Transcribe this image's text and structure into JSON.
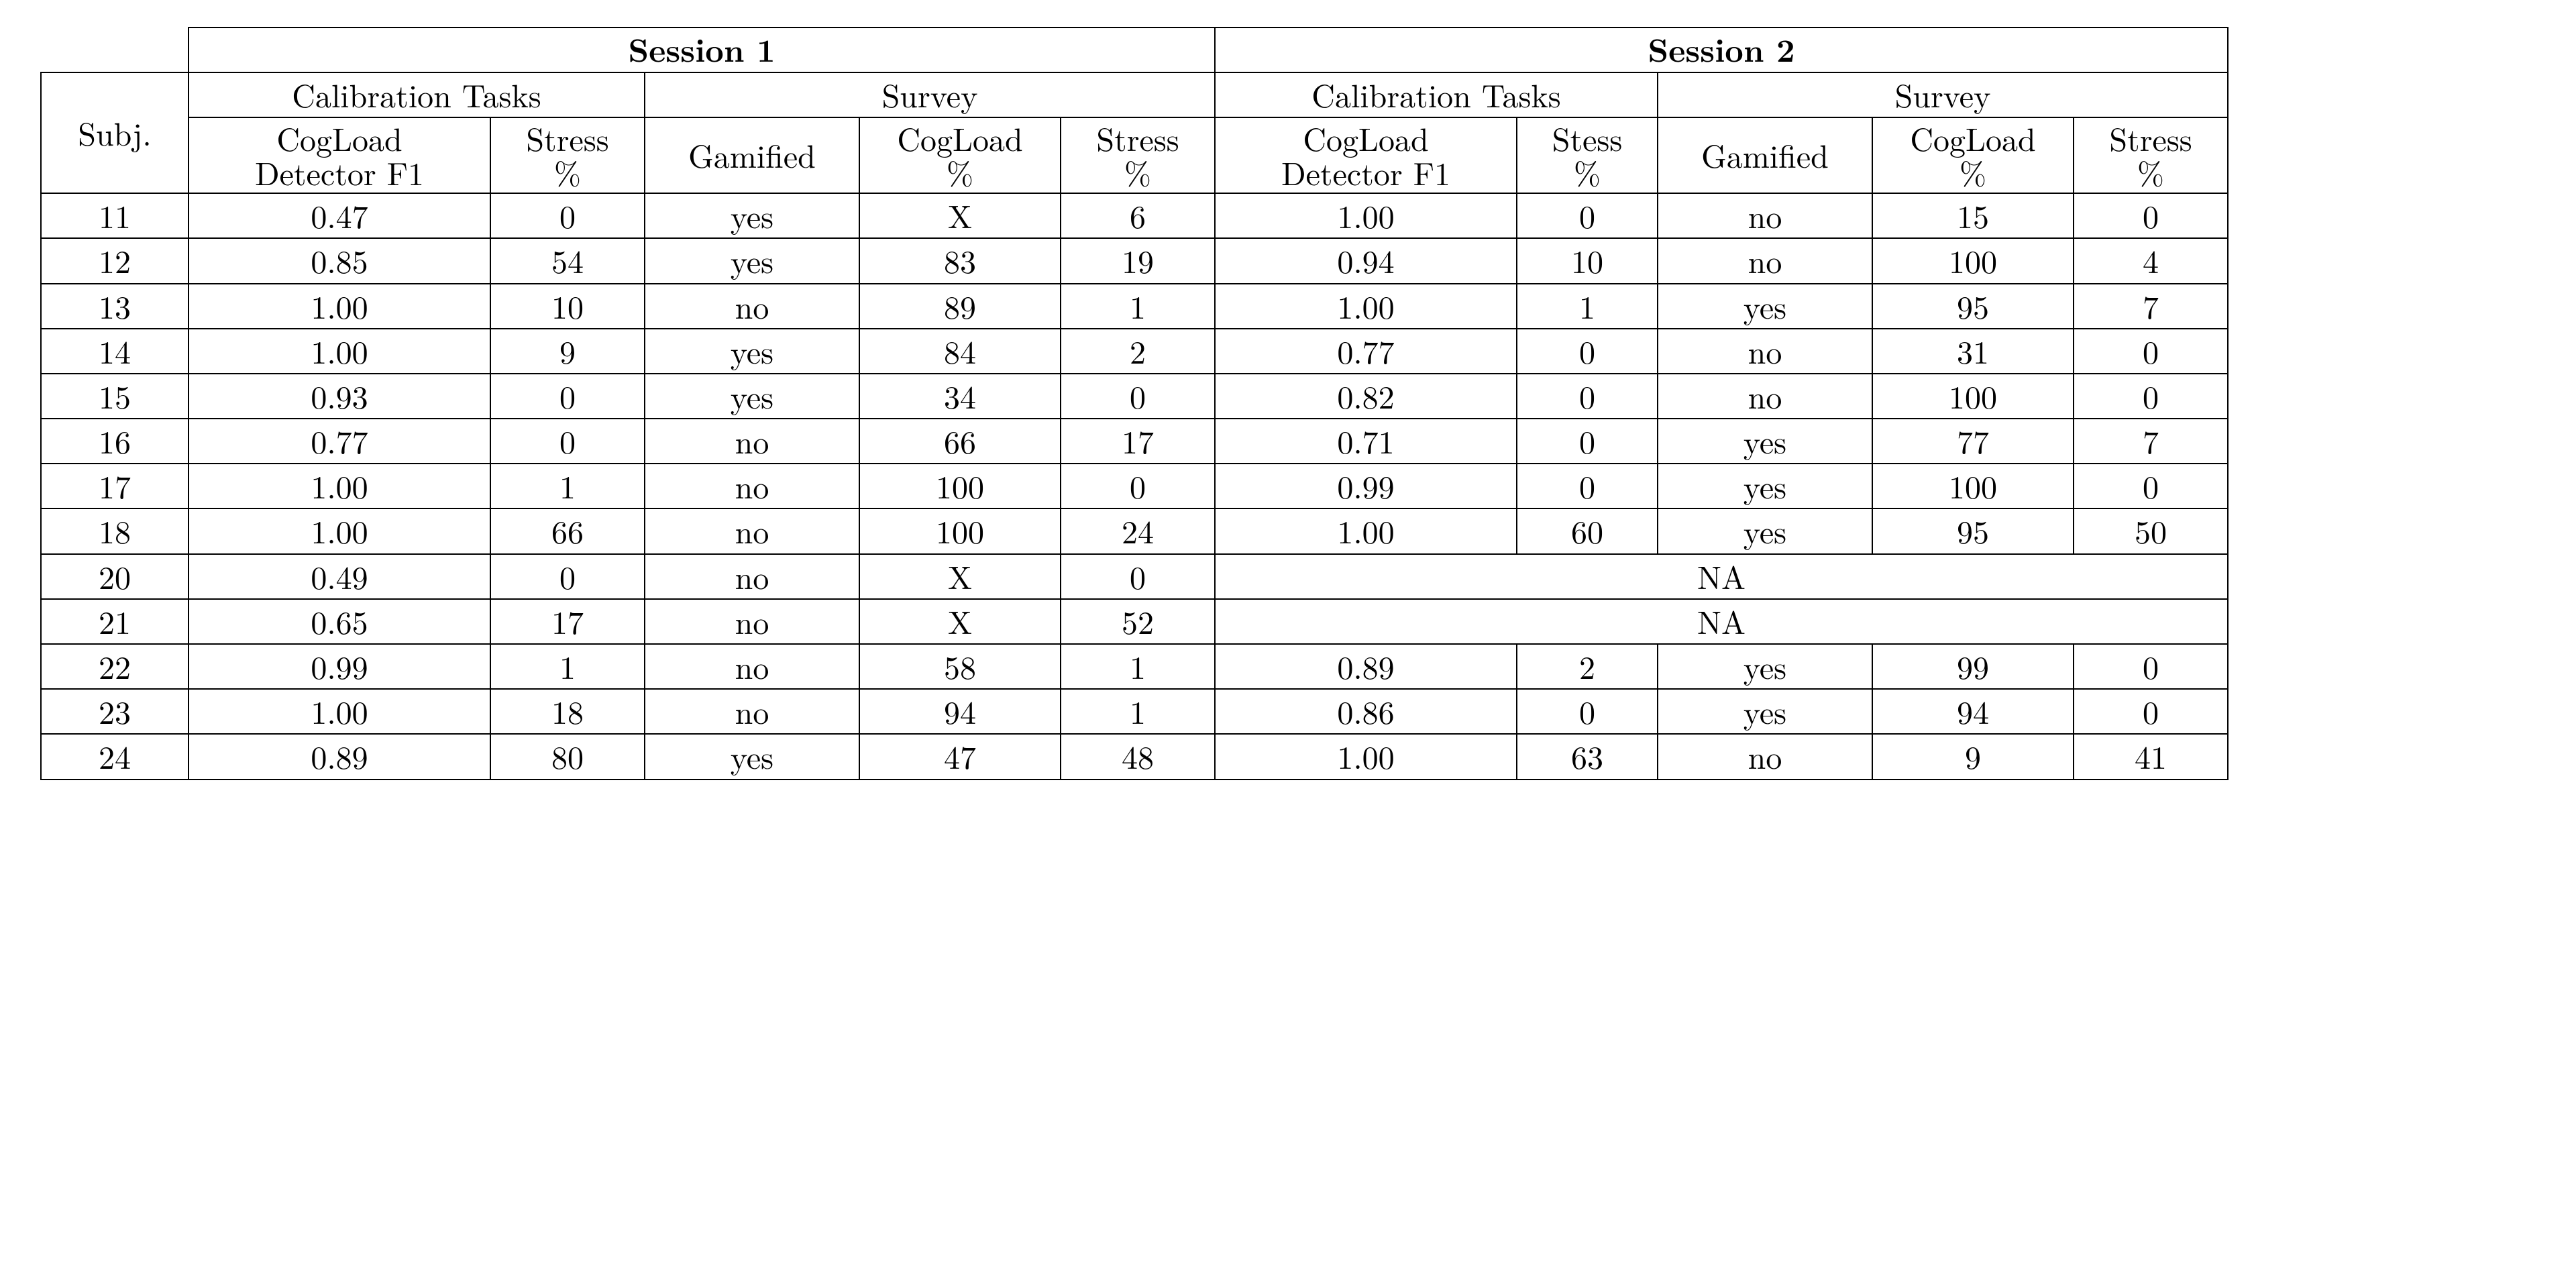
{
  "headers": {
    "subj": "Subj.",
    "session1": "Session 1",
    "session2": "Session 2",
    "calibration": "Calibration Tasks",
    "survey": "Survey",
    "cogload_f1_l1": "CogLoad",
    "cogload_f1_l2": "Detector F1",
    "stress_l1": "Stress",
    "stress_l2": "%",
    "stess_l1": "Stess",
    "gamified": "Gamified",
    "cogload_pct_l1": "CogLoad",
    "cogload_pct_l2": "%"
  },
  "na_label": "NA",
  "rows": [
    {
      "subj": "11",
      "s1": {
        "f1": "0.47",
        "st": "0",
        "gam": "yes",
        "cl": "X",
        "sp": "6"
      },
      "s2": {
        "f1": "1.00",
        "st": "0",
        "gam": "no",
        "cl": "15",
        "sp": "0"
      }
    },
    {
      "subj": "12",
      "s1": {
        "f1": "0.85",
        "st": "54",
        "gam": "yes",
        "cl": "83",
        "sp": "19"
      },
      "s2": {
        "f1": "0.94",
        "st": "10",
        "gam": "no",
        "cl": "100",
        "sp": "4"
      }
    },
    {
      "subj": "13",
      "s1": {
        "f1": "1.00",
        "st": "10",
        "gam": "no",
        "cl": "89",
        "sp": "1"
      },
      "s2": {
        "f1": "1.00",
        "st": "1",
        "gam": "yes",
        "cl": "95",
        "sp": "7"
      }
    },
    {
      "subj": "14",
      "s1": {
        "f1": "1.00",
        "st": "9",
        "gam": "yes",
        "cl": "84",
        "sp": "2"
      },
      "s2": {
        "f1": "0.77",
        "st": "0",
        "gam": "no",
        "cl": "31",
        "sp": "0"
      }
    },
    {
      "subj": "15",
      "s1": {
        "f1": "0.93",
        "st": "0",
        "gam": "yes",
        "cl": "34",
        "sp": "0"
      },
      "s2": {
        "f1": "0.82",
        "st": "0",
        "gam": "no",
        "cl": "100",
        "sp": "0"
      }
    },
    {
      "subj": "16",
      "s1": {
        "f1": "0.77",
        "st": "0",
        "gam": "no",
        "cl": "66",
        "sp": "17"
      },
      "s2": {
        "f1": "0.71",
        "st": "0",
        "gam": "yes",
        "cl": "77",
        "sp": "7"
      }
    },
    {
      "subj": "17",
      "s1": {
        "f1": "1.00",
        "st": "1",
        "gam": "no",
        "cl": "100",
        "sp": "0"
      },
      "s2": {
        "f1": "0.99",
        "st": "0",
        "gam": "yes",
        "cl": "100",
        "sp": "0"
      }
    },
    {
      "subj": "18",
      "s1": {
        "f1": "1.00",
        "st": "66",
        "gam": "no",
        "cl": "100",
        "sp": "24"
      },
      "s2": {
        "f1": "1.00",
        "st": "60",
        "gam": "yes",
        "cl": "95",
        "sp": "50"
      }
    },
    {
      "subj": "20",
      "s1": {
        "f1": "0.49",
        "st": "0",
        "gam": "no",
        "cl": "X",
        "sp": "0"
      },
      "s2": null
    },
    {
      "subj": "21",
      "s1": {
        "f1": "0.65",
        "st": "17",
        "gam": "no",
        "cl": "X",
        "sp": "52"
      },
      "s2": null
    },
    {
      "subj": "22",
      "s1": {
        "f1": "0.99",
        "st": "1",
        "gam": "no",
        "cl": "58",
        "sp": "1"
      },
      "s2": {
        "f1": "0.89",
        "st": "2",
        "gam": "yes",
        "cl": "99",
        "sp": "0"
      }
    },
    {
      "subj": "23",
      "s1": {
        "f1": "1.00",
        "st": "18",
        "gam": "no",
        "cl": "94",
        "sp": "1"
      },
      "s2": {
        "f1": "0.86",
        "st": "0",
        "gam": "yes",
        "cl": "94",
        "sp": "0"
      }
    },
    {
      "subj": "24",
      "s1": {
        "f1": "0.89",
        "st": "80",
        "gam": "yes",
        "cl": "47",
        "sp": "48"
      },
      "s2": {
        "f1": "1.00",
        "st": "63",
        "gam": "no",
        "cl": "9",
        "sp": "41"
      }
    }
  ],
  "chart_data": {
    "type": "table",
    "columns": [
      "Subj.",
      "Session1 Calibration CogLoad Detector F1",
      "Session1 Calibration Stress %",
      "Session1 Survey Gamified",
      "Session1 Survey CogLoad %",
      "Session1 Survey Stress %",
      "Session2 Calibration CogLoad Detector F1",
      "Session2 Calibration Stess %",
      "Session2 Survey Gamified",
      "Session2 Survey CogLoad %",
      "Session2 Survey Stress %"
    ],
    "rows": [
      [
        "11",
        "0.47",
        "0",
        "yes",
        "X",
        "6",
        "1.00",
        "0",
        "no",
        "15",
        "0"
      ],
      [
        "12",
        "0.85",
        "54",
        "yes",
        "83",
        "19",
        "0.94",
        "10",
        "no",
        "100",
        "4"
      ],
      [
        "13",
        "1.00",
        "10",
        "no",
        "89",
        "1",
        "1.00",
        "1",
        "yes",
        "95",
        "7"
      ],
      [
        "14",
        "1.00",
        "9",
        "yes",
        "84",
        "2",
        "0.77",
        "0",
        "no",
        "31",
        "0"
      ],
      [
        "15",
        "0.93",
        "0",
        "yes",
        "34",
        "0",
        "0.82",
        "0",
        "no",
        "100",
        "0"
      ],
      [
        "16",
        "0.77",
        "0",
        "no",
        "66",
        "17",
        "0.71",
        "0",
        "yes",
        "77",
        "7"
      ],
      [
        "17",
        "1.00",
        "1",
        "no",
        "100",
        "0",
        "0.99",
        "0",
        "yes",
        "100",
        "0"
      ],
      [
        "18",
        "1.00",
        "66",
        "no",
        "100",
        "24",
        "1.00",
        "60",
        "yes",
        "95",
        "50"
      ],
      [
        "20",
        "0.49",
        "0",
        "no",
        "X",
        "0",
        "NA",
        "NA",
        "NA",
        "NA",
        "NA"
      ],
      [
        "21",
        "0.65",
        "17",
        "no",
        "X",
        "52",
        "NA",
        "NA",
        "NA",
        "NA",
        "NA"
      ],
      [
        "22",
        "0.99",
        "1",
        "no",
        "58",
        "1",
        "0.89",
        "2",
        "yes",
        "99",
        "0"
      ],
      [
        "23",
        "1.00",
        "18",
        "no",
        "94",
        "1",
        "0.86",
        "0",
        "yes",
        "94",
        "0"
      ],
      [
        "24",
        "0.89",
        "80",
        "yes",
        "47",
        "48",
        "1.00",
        "63",
        "no",
        "9",
        "41"
      ]
    ]
  }
}
